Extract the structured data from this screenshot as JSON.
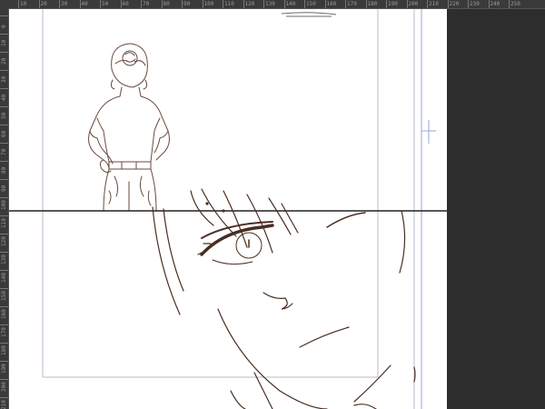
{
  "app": {
    "document_view": "canvas",
    "colors": {
      "pasteboard": "#2d2d2d",
      "ruler_bg": "#3a3a3a",
      "ruler_text": "#9a9a9a",
      "page_bg": "#ffffff",
      "frame_border": "#b8b8cc",
      "guide_blue": "#9aa6d8",
      "line_art": "#5a3a2e",
      "panel_divider": "#222222"
    }
  },
  "rulers": {
    "top_labels": [
      "10",
      "20",
      "30",
      "40",
      "50",
      "60",
      "70",
      "80",
      "90",
      "100",
      "110",
      "120",
      "130",
      "140",
      "150",
      "160",
      "170",
      "180",
      "190",
      "200",
      "210",
      "220",
      "230",
      "240",
      "250"
    ],
    "left_labels": [
      "0",
      "10",
      "20",
      "30",
      "40",
      "50",
      "60",
      "70",
      "80",
      "90",
      "100",
      "110",
      "120",
      "130",
      "140",
      "150",
      "160",
      "170",
      "180",
      "190",
      "200",
      "210"
    ]
  },
  "canvas": {
    "panels": [
      {
        "name": "upper-panel",
        "content": "girl-back-view"
      },
      {
        "name": "lower-panel",
        "content": "face-closeup"
      }
    ]
  }
}
